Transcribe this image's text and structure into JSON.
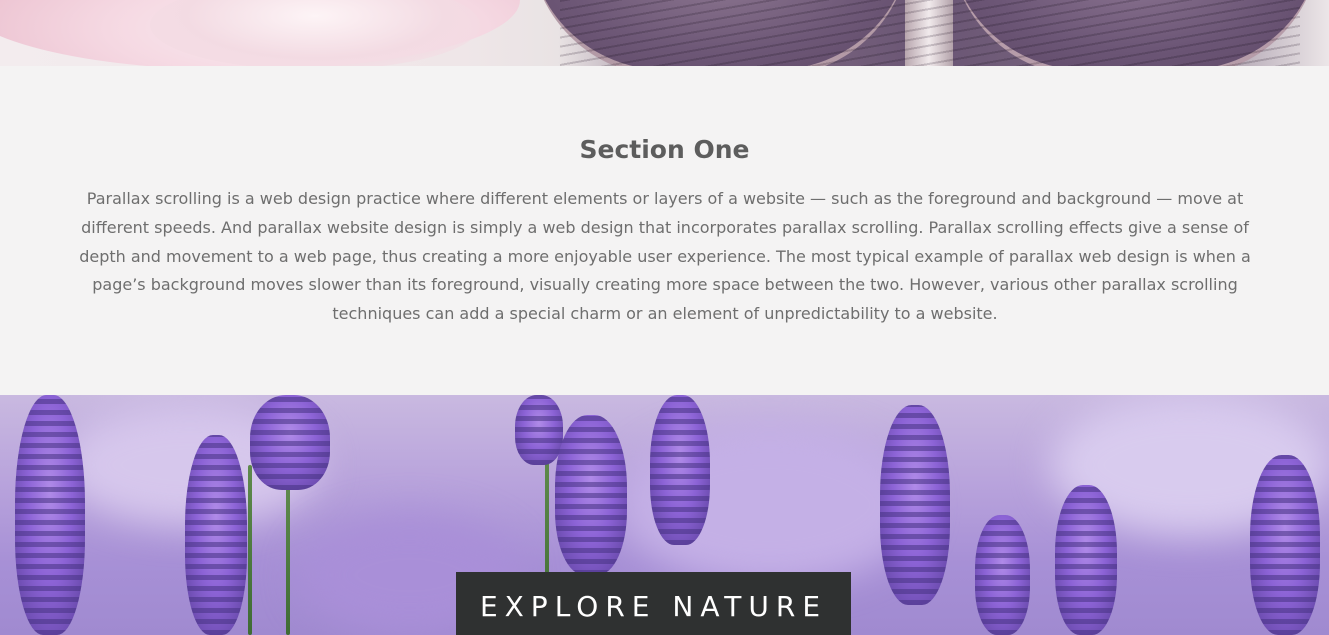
{
  "section_one": {
    "title": "Section One",
    "body": "Parallax scrolling is a web design practice where different elements or layers of a website — such as the foreground and background — move at different speeds. And parallax website design is simply a web design that incorporates parallax scrolling. Parallax scrolling effects give a sense of depth and movement to a web page, thus creating a more enjoyable user experience. The most typical example of parallax web design is when a page’s background moves slower than its foreground, visually creating more space between the two. However, various other parallax scrolling techniques can add a special charm or an element of unpredictability to a website."
  },
  "explore": {
    "label": "EXPLORE NATURE"
  },
  "colors": {
    "section_bg": "#f4f3f3",
    "title_text": "#5d5d5d",
    "body_text": "#6e6e6e",
    "button_bg": "#2f3131",
    "button_text": "#ffffff"
  }
}
